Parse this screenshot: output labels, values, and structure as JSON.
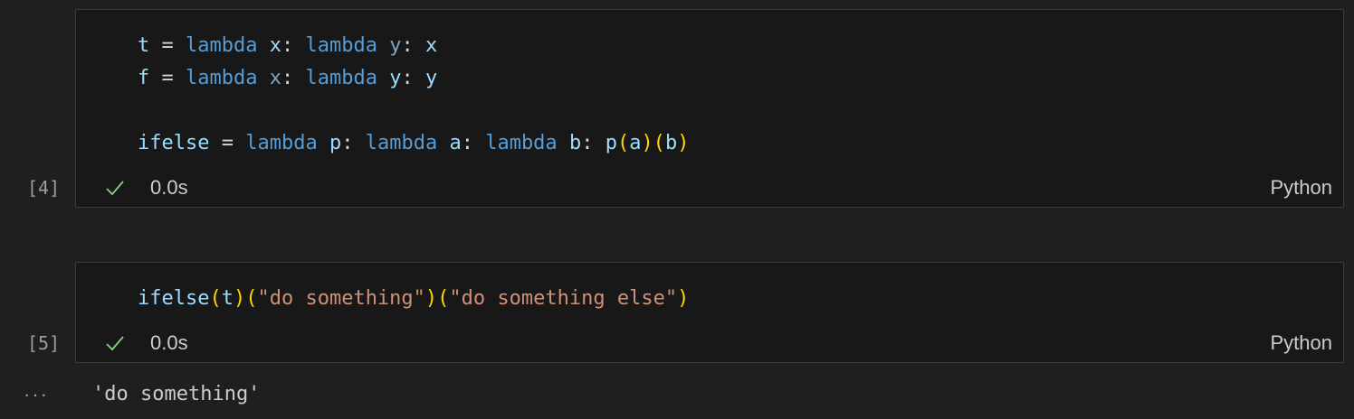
{
  "cells": [
    {
      "execution_count": "[4]",
      "duration": "0.0s",
      "language": "Python",
      "code_lines": [
        "t = lambda x: lambda y: x",
        "f = lambda x: lambda y: y",
        "",
        "ifelse = lambda p: lambda a: lambda b: p(a)(b)"
      ]
    },
    {
      "execution_count": "[5]",
      "duration": "0.0s",
      "language": "Python",
      "code_lines": [
        "ifelse(t)(\"do something\")(\"do something else\")"
      ]
    }
  ],
  "output": {
    "more_icon": "ellipsis-icon",
    "more_glyph": "···",
    "text": "'do something'"
  },
  "colors": {
    "background": "#1f1f1f",
    "cell_background": "#181818",
    "keyword": "#569cd6",
    "variable": "#9cdcfe",
    "bracket": "#ffd700",
    "string": "#ce9178",
    "success_check": "#89d185"
  },
  "icons": {
    "status": "check-icon"
  }
}
